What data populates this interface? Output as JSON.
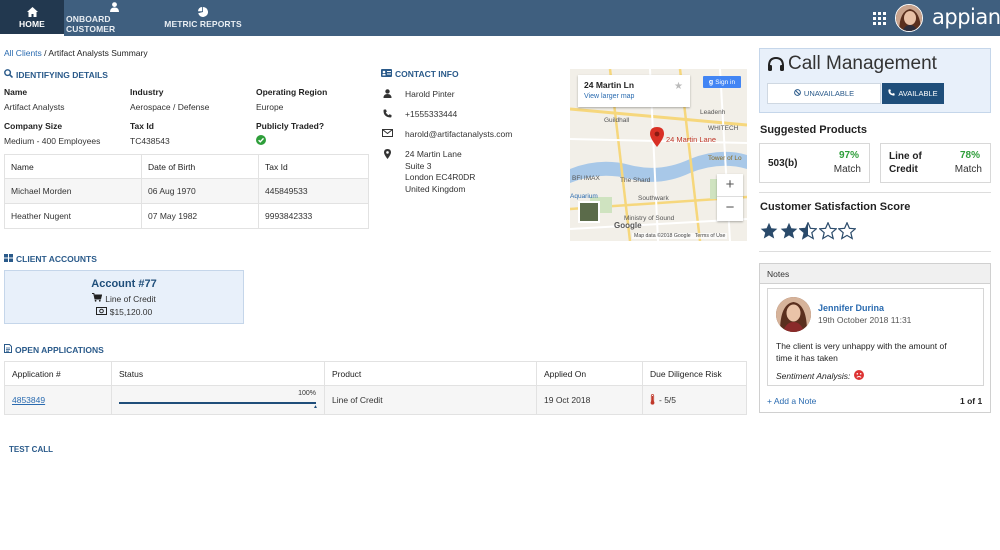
{
  "nav": {
    "tabs": [
      {
        "label": "HOME",
        "icon": "home-icon"
      },
      {
        "label": "ONBOARD CUSTOMER",
        "icon": "user-icon"
      },
      {
        "label": "METRIC REPORTS",
        "icon": "pie-chart-icon"
      }
    ],
    "brand": "appian"
  },
  "breadcrumb": {
    "root": "All Clients",
    "separator": " / ",
    "current": "Artifact Analysts Summary"
  },
  "identifying": {
    "title": "IDENTIFYING DETAILS",
    "fields": {
      "name_label": "Name",
      "name_value": "Artifact Analysts",
      "industry_label": "Industry",
      "industry_value": "Aerospace / Defense",
      "region_label": "Operating Region",
      "region_value": "Europe",
      "size_label": "Company Size",
      "size_value": "Medium - 400 Employees",
      "taxid_label": "Tax Id",
      "taxid_value": "TC438543",
      "traded_label": "Publicly Traded?"
    },
    "table": {
      "headers": [
        "Name",
        "Date of Birth",
        "Tax Id"
      ],
      "rows": [
        [
          "Michael Morden",
          "06 Aug 1970",
          "445849533"
        ],
        [
          "Heather Nugent",
          "07 May 1982",
          "9993842333"
        ]
      ]
    }
  },
  "contact": {
    "title": "CONTACT INFO",
    "person": "Harold Pinter",
    "phone": "+1555333444",
    "email": "harold@artifactanalysts.com",
    "address": [
      "24 Martin Lane",
      "Suite 3",
      "London EC4R0DR",
      "United Kingdom"
    ]
  },
  "map": {
    "place": "24 Martin Ln",
    "larger": "View larger map",
    "signin": "Sign in",
    "pin_label": "24 Martin Lane",
    "labels": [
      "Guildhall",
      "WHITECH",
      "Tower of Lo",
      "BFI IMAX",
      "The Shard",
      "Southwark",
      "Ministry of Sound",
      "Aquarium",
      "Leadenh",
      "Google"
    ],
    "footer": "Map data ©2018 Google   Terms of Use",
    "zoom_in": "+",
    "zoom_out": "−"
  },
  "accounts": {
    "title": "CLIENT ACCOUNTS",
    "card": {
      "name": "Account #77",
      "type": "Line of Credit",
      "amount": "$15,120.00"
    }
  },
  "applications": {
    "title": "OPEN APPLICATIONS",
    "headers": [
      "Application #",
      "Status",
      "Product",
      "Applied On",
      "Due Diligence Risk"
    ],
    "rows": [
      {
        "id": "4853849",
        "progress_label": "100%",
        "progress": 1.0,
        "product": "Line of Credit",
        "applied_on": "19 Oct 2018",
        "risk": "- 5/5"
      }
    ]
  },
  "test_call": "TEST CALL",
  "call": {
    "title": "Call Management",
    "unavailable": "UNAVAILABLE",
    "available": "AVAILABLE"
  },
  "suggested": {
    "title": "Suggested Products",
    "items": [
      {
        "name": "503(b)",
        "pct": "97%",
        "match": "Match"
      },
      {
        "name_line1": "Line of",
        "name_line2": "Credit",
        "pct": "78%",
        "match": "Match"
      }
    ]
  },
  "satisfaction": {
    "title": "Customer Satisfaction Score",
    "rating": 2.5,
    "max": 5
  },
  "notes": {
    "title": "Notes",
    "author": "Jennifer Durina",
    "date": "19th October 2018 11:31",
    "text_line1": "The client is very unhappy with the amount of",
    "text_line2": "time it has taken",
    "sentiment": "Sentiment Analysis:",
    "add": "+ Add a Note",
    "pager": "1 of 1"
  },
  "colors": {
    "nav": "#3f5f7f",
    "nav_active": "#22384f",
    "accent": "#2a5a8a",
    "green": "#2e9e3a",
    "star": "#2a4a6a"
  }
}
